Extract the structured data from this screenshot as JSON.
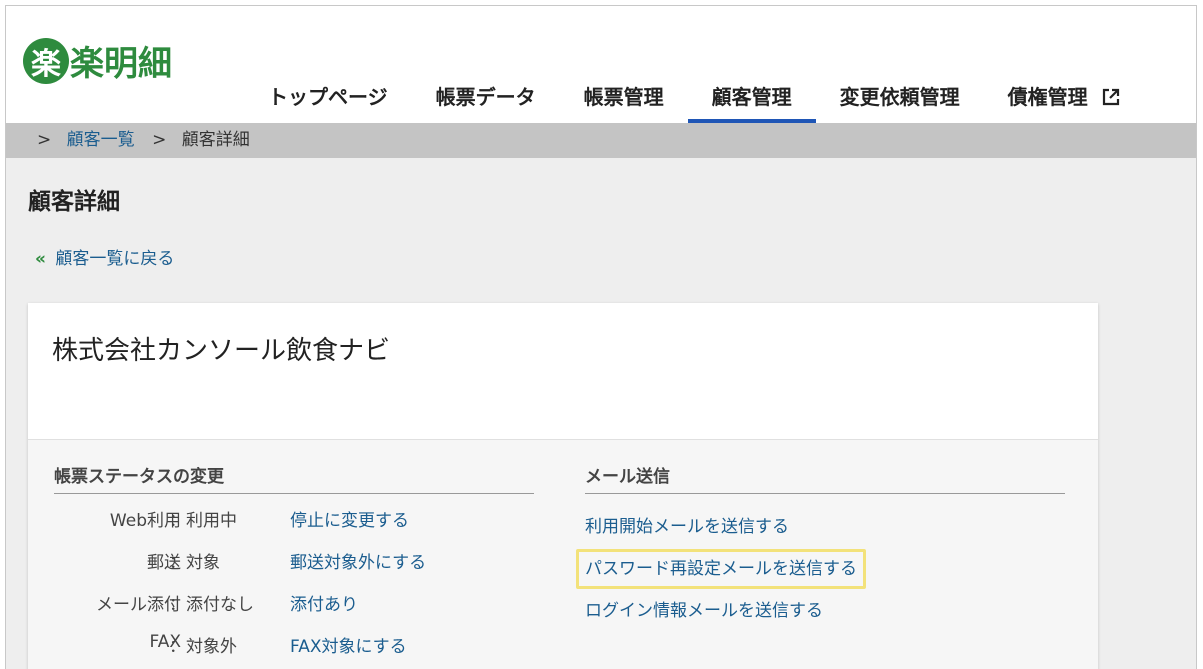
{
  "header": {
    "logo_mark": "楽",
    "logo_text": "楽明細",
    "nav": [
      {
        "label": "トップページ",
        "active": false
      },
      {
        "label": "帳票データ",
        "active": false
      },
      {
        "label": "帳票管理",
        "active": false
      },
      {
        "label": "顧客管理",
        "active": true
      },
      {
        "label": "変更依頼管理",
        "active": false
      },
      {
        "label": "債権管理",
        "active": false,
        "external": true
      }
    ]
  },
  "breadcrumb": {
    "sep": ">",
    "link": "顧客一覧",
    "current": "顧客詳細"
  },
  "page": {
    "title": "顧客詳細",
    "back_chevron": "«",
    "back_label": "顧客一覧に戻る"
  },
  "card": {
    "company_name": "株式会社カンソール飲食ナビ",
    "status_section": {
      "title": "帳票ステータスの変更",
      "rows": [
        {
          "label": "Web利用",
          "value": "：利用中",
          "action": "停止に変更する"
        },
        {
          "label": "郵送",
          "value": "：対象",
          "action": "郵送対象外にする"
        },
        {
          "label": "メール添付",
          "value": "：添付なし",
          "action": "添付あり"
        },
        {
          "label": "FAX",
          "value": "：対象外",
          "action": "FAX対象にする"
        }
      ]
    },
    "mail_section": {
      "title": "メール送信",
      "items": [
        {
          "label": "利用開始メールを送信する",
          "highlighted": false
        },
        {
          "label": "パスワード再設定メールを送信する",
          "highlighted": true
        },
        {
          "label": "ログイン情報メールを送信する",
          "highlighted": false
        }
      ]
    }
  },
  "colors": {
    "brand_green": "#2e8b3e",
    "active_tab": "#1f56b6",
    "link": "#1b5d8f",
    "highlight": "#f3e27a"
  }
}
